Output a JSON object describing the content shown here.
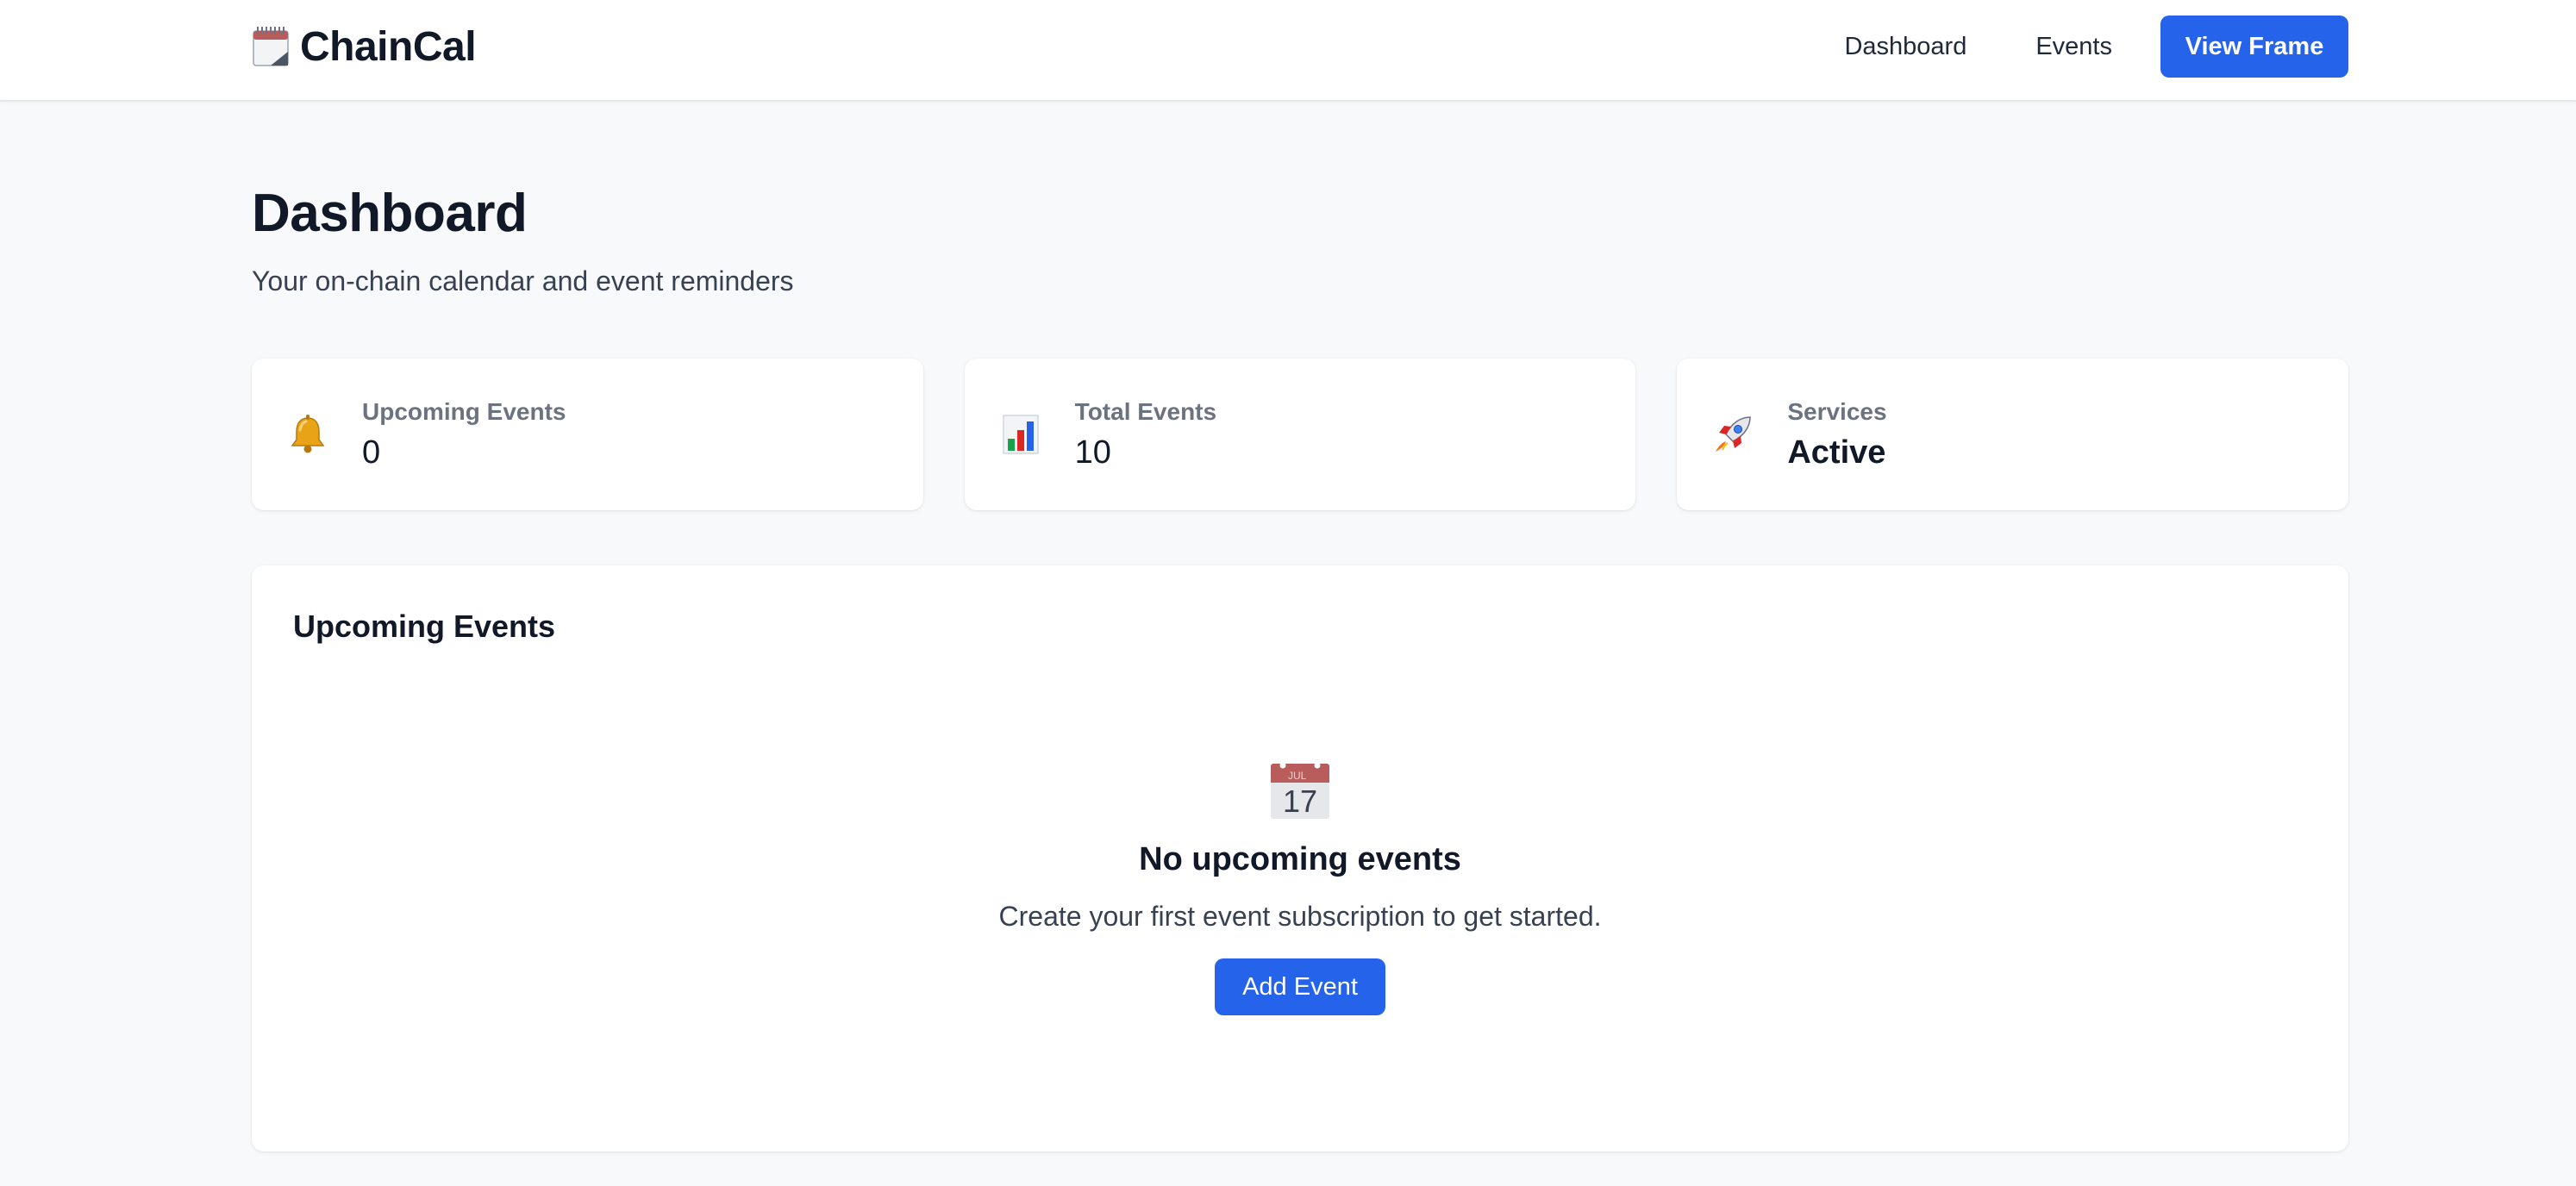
{
  "app": {
    "brand_name": "ChainCal",
    "brand_icon": "spiral-calendar-icon"
  },
  "nav": {
    "dashboard_label": "Dashboard",
    "events_label": "Events",
    "view_frame_label": "View Frame"
  },
  "page": {
    "title": "Dashboard",
    "subtitle": "Your on-chain calendar and event reminders"
  },
  "stats": [
    {
      "icon": "bell-icon",
      "label": "Upcoming Events",
      "value": "0"
    },
    {
      "icon": "bar-chart-icon",
      "label": "Total Events",
      "value": "10"
    },
    {
      "icon": "rocket-icon",
      "label": "Services",
      "value": "Active"
    }
  ],
  "upcoming": {
    "title": "Upcoming Events",
    "empty_icon": "calendar-icon",
    "empty_icon_month": "JUL",
    "empty_icon_day": "17",
    "empty_title": "No upcoming events",
    "empty_text": "Create your first event subscription to get started.",
    "add_button_label": "Add Event"
  },
  "colors": {
    "accent": "#2563eb",
    "background": "#f8f9fb",
    "card": "#ffffff",
    "text_primary": "#111827",
    "text_muted": "#6b7280"
  }
}
